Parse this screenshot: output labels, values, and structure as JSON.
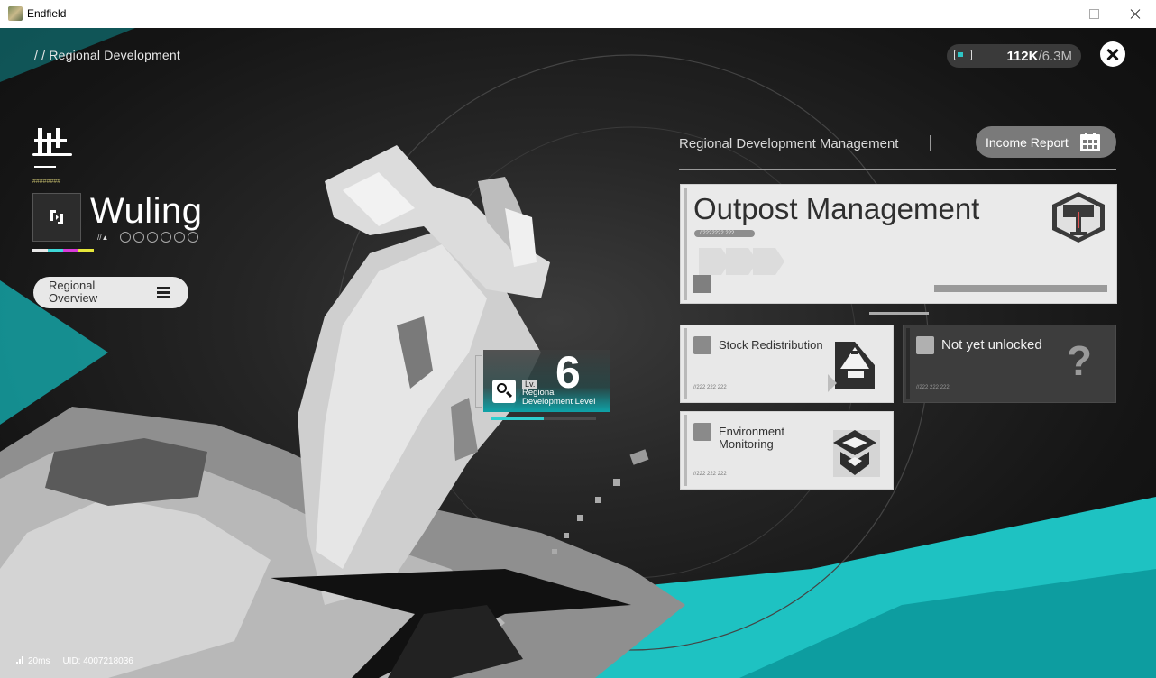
{
  "window": {
    "title": "Endfield"
  },
  "header": {
    "breadcrumb": "/ / Regional Development",
    "currency_current": "112K",
    "currency_max": "/6.3M",
    "close_icon": "close-x-icon"
  },
  "region": {
    "name": "Wuling",
    "subtext": "//▲",
    "stripes": "########",
    "overview_button": "Regional Overview"
  },
  "level": {
    "value": "6",
    "tag": "Lv.",
    "caption": "Regional Development Level",
    "progress": 0.5
  },
  "management": {
    "title": "Regional Development Management",
    "income_button": "Income Report",
    "outpost": {
      "title": "Outpost Management",
      "code": "//2222222 222"
    },
    "tiles": [
      {
        "label": "Stock Redistribution",
        "code": "//222 222 222",
        "locked": false,
        "icon": "stock-redistribution-icon"
      },
      {
        "label": "Not yet unlocked",
        "code": "//222 222 222",
        "locked": true,
        "icon": "question-mark-icon"
      },
      {
        "label": "Environment Monitoring",
        "code": "//222 222 222",
        "locked": false,
        "icon": "environment-monitoring-icon"
      }
    ]
  },
  "status": {
    "ping": "20ms",
    "uid": "UID: 4007218036"
  },
  "colors": {
    "accent": "#2fcfcf",
    "panel_light": "#eaeaea",
    "panel_dark": "#3d3d3d"
  }
}
